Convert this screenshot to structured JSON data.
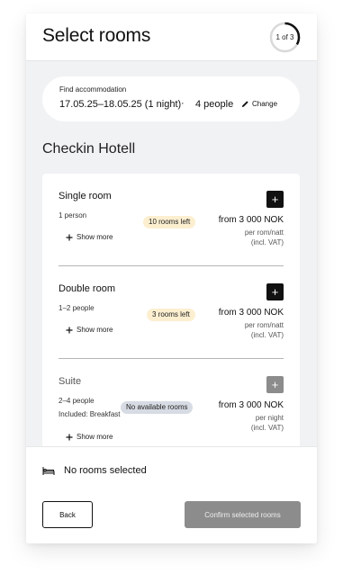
{
  "header": {
    "title": "Select rooms",
    "step": "1 of 3",
    "step_progress": 0.333
  },
  "search": {
    "label": "Find accommodation",
    "dates": "17.05.25–18.05.25 (1 night)",
    "separator": "·",
    "people": "4 people",
    "change_label": "Change"
  },
  "hotel": {
    "name": "Checkin Hotell"
  },
  "rooms": [
    {
      "name": "Single room",
      "people": "1 person",
      "extra": "",
      "show_more": "Show more",
      "badge": "10 rooms left",
      "badge_type": "warn",
      "price": "from 3 000 NOK",
      "unit": "per rom/natt",
      "vat": "(incl. VAT)",
      "available": true
    },
    {
      "name": "Double room",
      "people": "1–2 people",
      "extra": "",
      "show_more": "Show more",
      "badge": "3 rooms left",
      "badge_type": "warn",
      "price": "from 3 000 NOK",
      "unit": "per rom/natt",
      "vat": "(incl. VAT)",
      "available": true
    },
    {
      "name": "Suite",
      "people": "2–4 people",
      "extra": "Included: Breakfast",
      "show_more": "Show more",
      "badge": "No available rooms",
      "badge_type": "none",
      "price": "from 3 000 NOK",
      "unit": "per night",
      "vat": "(incl. VAT)",
      "available": false
    }
  ],
  "footer": {
    "status": "No rooms selected",
    "back_label": "Back",
    "confirm_label": "Confirm selected rooms"
  },
  "colors": {
    "primary": "#111111",
    "disabled": "#8c8c8c",
    "badge_warn": "#fcefd0",
    "badge_none": "#d7dbe3",
    "background": "#f1f2f4"
  },
  "icons": {
    "change": "pencil-icon",
    "show_more": "plus-icon",
    "add": "plus-icon",
    "status": "bed-icon"
  }
}
